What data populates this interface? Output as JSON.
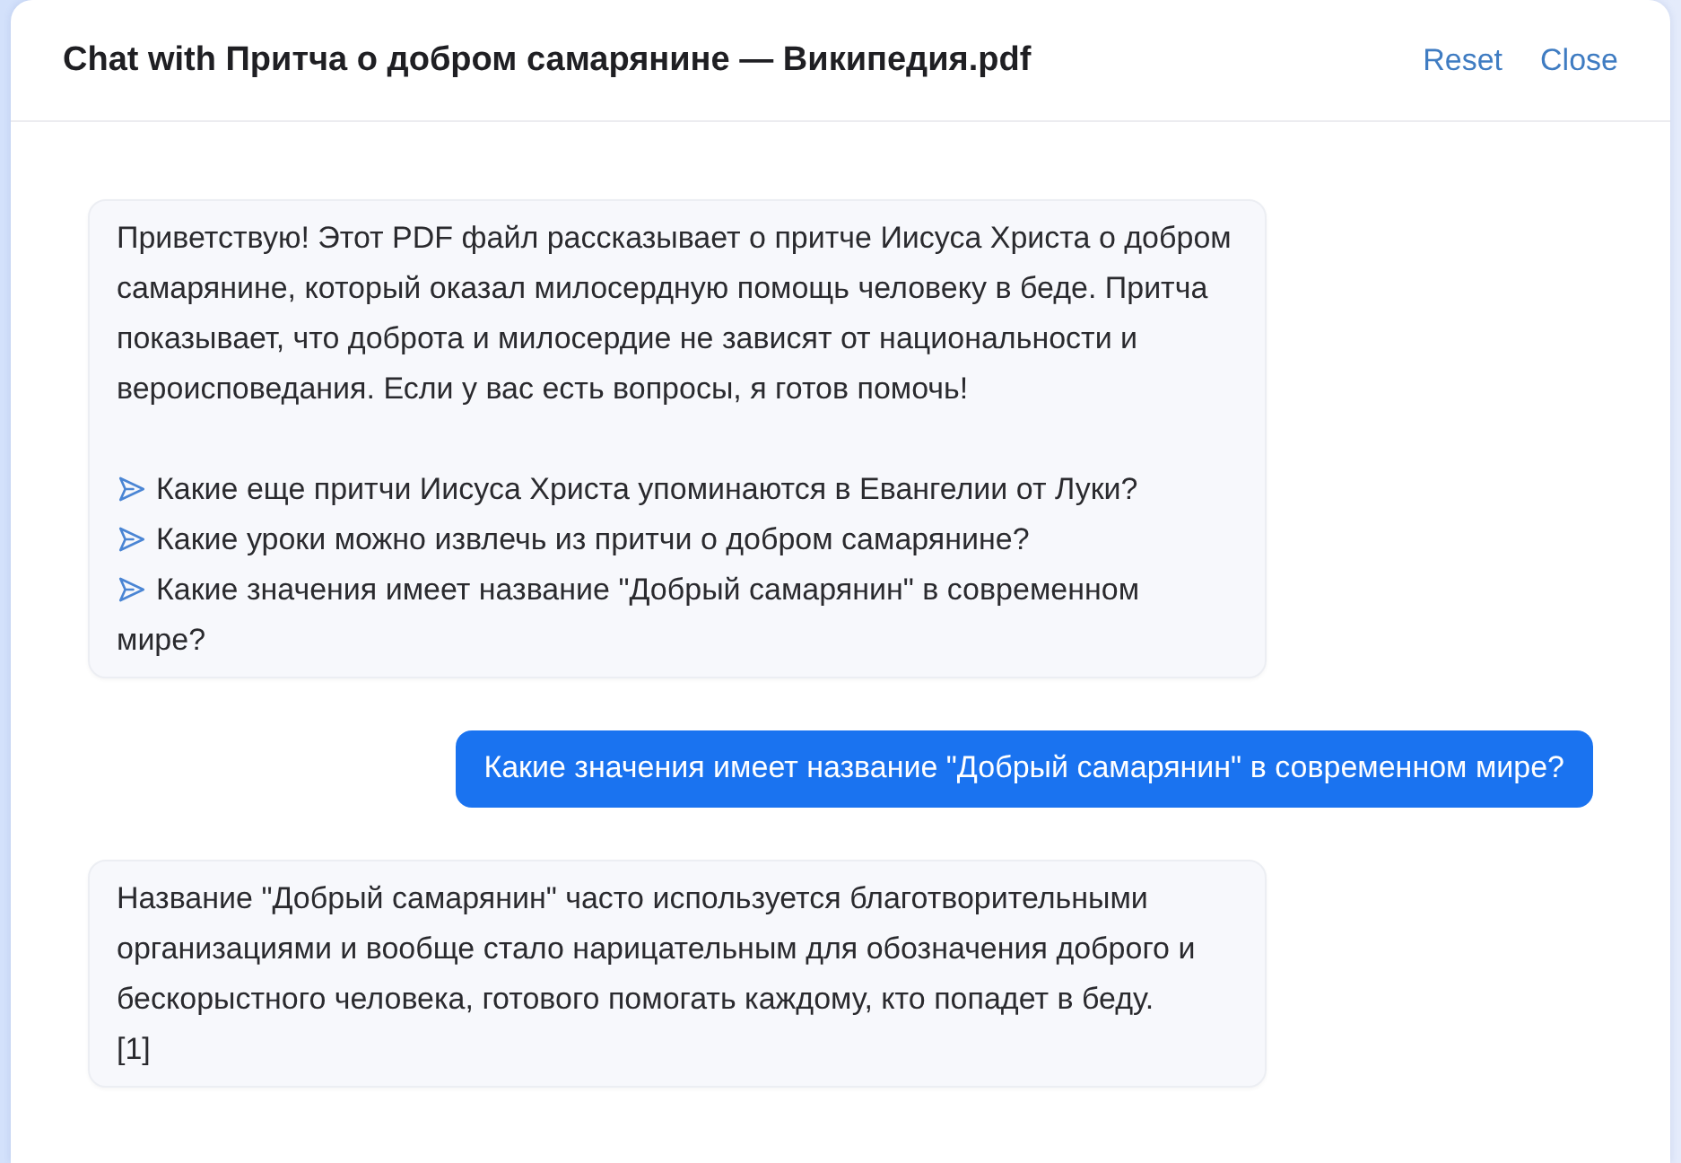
{
  "header": {
    "title": "Chat with Притча о добром самарянине — Википедия.pdf",
    "reset": "Reset",
    "close": "Close"
  },
  "messages": [
    {
      "kind": "assistant",
      "text": "Приветствую! Этот PDF файл рассказывает о притче Иисуса Христа о добром самарянине, который оказал милосердную помощь человеку в беде. Притча показывает, что доброта и милосердие не зависят от национальности и вероисповедания. Если у вас есть вопросы, я готов помочь!",
      "suggestions": [
        "Какие еще притчи Иисуса Христа упоминаются в Евангелии от Луки?",
        "Какие уроки можно извлечь из притчи о добром самарянине?",
        "Какие значения имеет название \"Добрый самарянин\" в современном мире?"
      ]
    },
    {
      "kind": "user",
      "text": "Какие значения имеет название \"Добрый самарянин\" в современном мире?"
    },
    {
      "kind": "assistant",
      "text": "Название \"Добрый самарянин\" часто используется благотворительными организациями и вообще стало нарицательным для обозначения доброго и бескорыстного человека, готового помогать каждому, кто попадет в беду.",
      "citations": [
        "[1]"
      ]
    }
  ]
}
